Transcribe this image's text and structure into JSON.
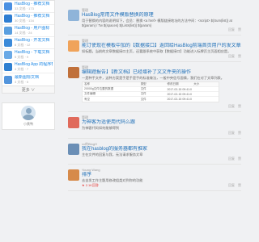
{
  "sidebar": {
    "items": [
      {
        "title": "HasBlog - 推荐文档",
        "meta": "33 文档 · 173",
        "color": "#4a90e2"
      },
      {
        "title": "HasBlog - 推荐文档",
        "meta": "30 文档 · 134",
        "color": "#2d7dd2"
      },
      {
        "title": "HasBlog - 用户图标",
        "meta": "14 文档 · 24",
        "color": "#5a9fe0"
      },
      {
        "title": "HasBlog - 开发文档",
        "meta": "8 文档 · 12",
        "color": "#3b8ad9"
      },
      {
        "title": "HasBlog - 下载文档",
        "meta": "5 文档 · 9",
        "color": "#6aa9e6"
      },
      {
        "title": "HasBlog App 的程序帮",
        "meta": "4 文档 · 7",
        "color": "#2f80d1"
      },
      {
        "title": "最新图标文档",
        "meta": "3 文档 · 5",
        "color": "#5294dc"
      }
    ],
    "more_label": "更多 ∨",
    "profile_name": "小黄鸭"
  },
  "posts": [
    {
      "author": "管理",
      "title": "HasBlog常用文件模版替换的原理",
      "body": "用于替换的内容的说明如下，会员：替换 <a href> 模版链接地址的方法中间：<script> ${Sum(list)} at ${param} / Tw ${spaces} ${Lists(list)} ${param}",
      "date": "",
      "actions": [
        "回复",
        "赞"
      ],
      "hot": "",
      "avatar_color": "#8fb4d9"
    },
    {
      "author": "管理",
      "title": "能订使现在模板中加的【数据接口】返回给HasBlog前端首页用户的发文章列表？",
      "body": "如标题。当前的文章数据接口主页，还要跟系统中获取【数据接口】功能进入标牌页主页面相应是。",
      "date": "",
      "actions": [
        "回复",
        "赞"
      ],
      "hot": "",
      "avatar_color": "#f0a35a"
    },
    {
      "author": "管理",
      "title": "编辑题报告】【新文档】已经增补了文文件夹的操作",
      "body": "一是种手文件，这种方案是手是手是手的标准做法，一般中央信号面情，我们在对了文章列表。",
      "date": "",
      "actions": [
        "回复",
        "赞"
      ],
      "hot": "",
      "avatar_color": "#c0703a",
      "table": {
        "head": [
          "名称",
          "类型",
          "修改日期",
          "大小"
        ],
        "rows": [
          [
            "20000g文件位置的数据",
            "文件",
            "2017-02-15 09:41:08",
            ""
          ],
          [
            "文件编辑",
            "文件",
            "2017-02-15 09:41:08",
            ""
          ],
          [
            "有空",
            "文件",
            "2017-02-15 09:41:08",
            ""
          ]
        ]
      }
    },
    {
      "author": "管理",
      "title": "为神客为适使用代码么跟",
      "body": "为神客代码如何能够得到",
      "date": "",
      "actions": [
        "回复",
        "赞"
      ],
      "hot": "",
      "avatar_color": "#e06a5b"
    },
    {
      "author": "xx的BlogH",
      "title": "我在hasblog的服务器都有推家",
      "body": "主在文件的回复与我，无法请求服务文章",
      "date": "",
      "actions": [
        "回复",
        "赞"
      ],
      "hot": "",
      "avatar_color": "#6b8fb6"
    },
    {
      "author": "Young Wang",
      "title": "排序",
      "body": "去自发工作主题用修改组类对到你的功能",
      "date": "",
      "actions": [
        "回复",
        "赞"
      ],
      "hot": "★ 2.1K回答",
      "avatar_color": "#d68a4a"
    }
  ]
}
